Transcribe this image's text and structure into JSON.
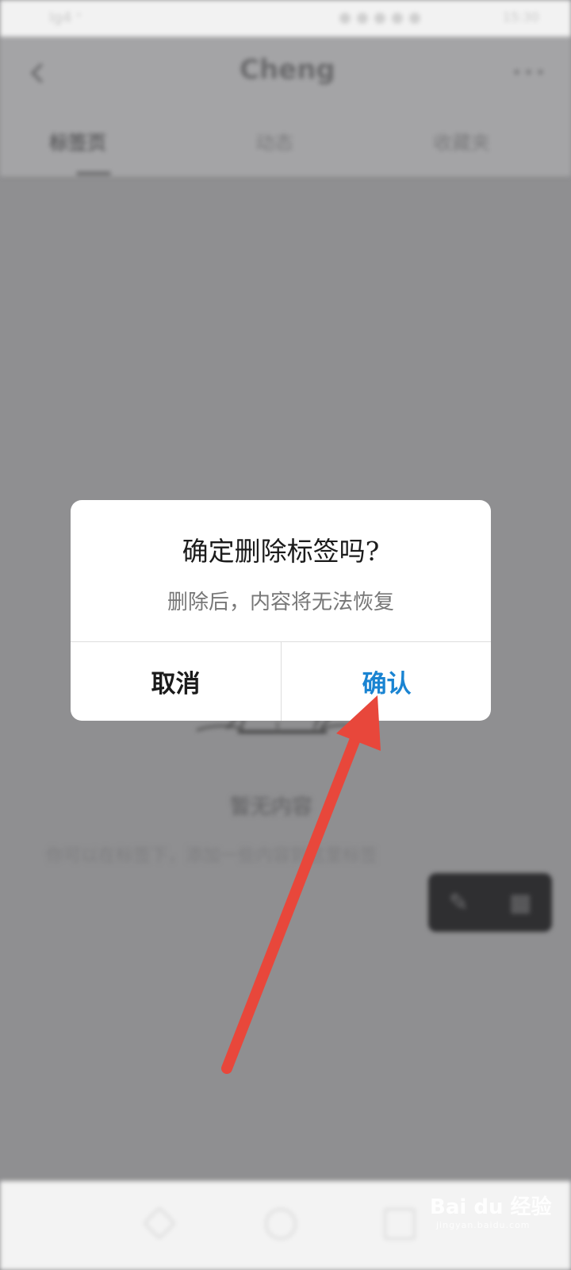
{
  "status_bar": {
    "left": "Ig4 ᐩ",
    "right": "15:30"
  },
  "header": {
    "title": "Cheng",
    "more": "•••",
    "tabs": [
      {
        "label": "标签页"
      },
      {
        "label": "动态"
      },
      {
        "label": "收藏夹"
      }
    ]
  },
  "empty_state": {
    "title": "暂无内容",
    "description": "你可以在标签下，添加一些内容到这里标签"
  },
  "float_bar": {
    "icons": [
      "edit-icon",
      "grid-icon"
    ]
  },
  "dialog": {
    "title": "确定删除标签吗?",
    "message": "删除后，内容将无法恢复",
    "cancel_label": "取消",
    "confirm_label": "确认"
  },
  "watermark": {
    "text": "Bai du 经验",
    "sub": "jingyan.baidu.com"
  },
  "colors": {
    "accent": "#1a84d2",
    "arrow": "#e8473b",
    "scrim": "#8f8f91"
  }
}
